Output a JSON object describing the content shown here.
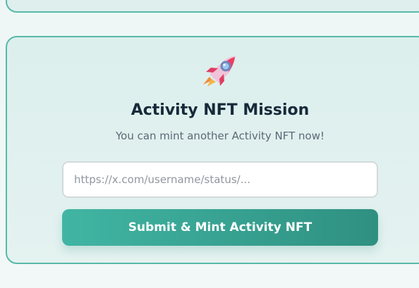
{
  "mission": {
    "icon": "rocket-icon",
    "title": "Activity NFT Mission",
    "subtitle": "You can mint another Activity NFT now!",
    "input_placeholder": "https://x.com/username/status/...",
    "submit_label": "Submit & Mint Activity NFT"
  },
  "colors": {
    "accent": "#3fae9d",
    "card_border": "#58b9a9",
    "card_background": "#deefed",
    "title_text": "#172a3a",
    "subtitle_text": "#5d6877"
  }
}
